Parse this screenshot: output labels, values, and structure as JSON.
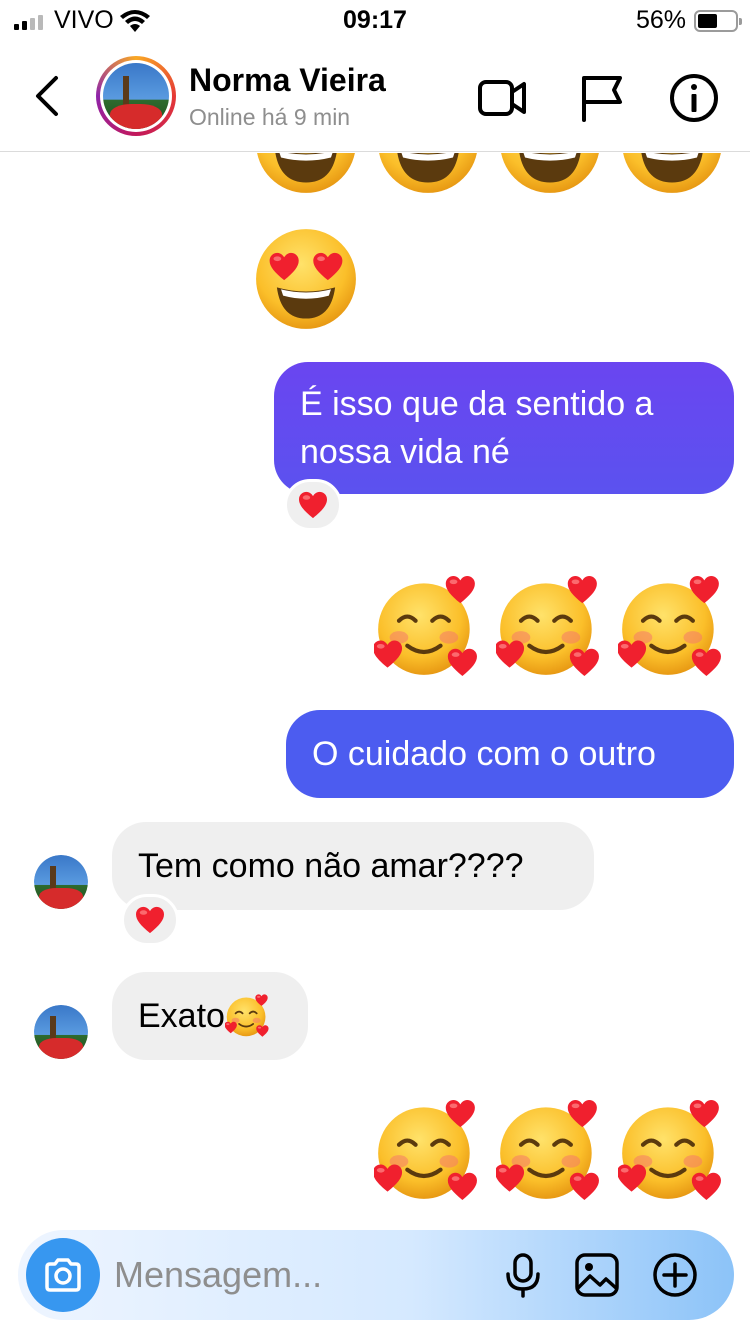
{
  "status_bar": {
    "carrier": "VIVO",
    "time": "09:17",
    "battery_percent": "56%",
    "battery_level": 0.56,
    "signal_bars": 2
  },
  "header": {
    "contact_name": "Norma Vieira",
    "contact_status": "Online há 9 min",
    "icons": [
      "back-icon",
      "video-call-icon",
      "flag-icon",
      "info-icon"
    ]
  },
  "messages": [
    {
      "type": "emoji",
      "side": "out",
      "emojis": [
        "grinning-face",
        "grinning-face",
        "grinning-face",
        "grinning-face"
      ]
    },
    {
      "type": "emoji",
      "side": "out",
      "emojis": [
        "heart-eyes-face"
      ]
    },
    {
      "type": "text",
      "side": "out",
      "text": "É isso que da sentido a nossa vida né",
      "reaction": "red-heart"
    },
    {
      "type": "emoji",
      "side": "out",
      "emojis": [
        "smiling-face-with-hearts",
        "smiling-face-with-hearts",
        "smiling-face-with-hearts"
      ]
    },
    {
      "type": "text",
      "side": "out",
      "text": "O cuidado com o outro"
    },
    {
      "type": "text",
      "side": "in",
      "text": "Tem como não amar????",
      "reaction": "red-heart"
    },
    {
      "type": "text",
      "side": "in",
      "text": "Exato",
      "inline_emoji": "smiling-face-with-hearts"
    },
    {
      "type": "emoji",
      "side": "out",
      "emojis": [
        "smiling-face-with-hearts",
        "smiling-face-with-hearts",
        "smiling-face-with-hearts"
      ]
    }
  ],
  "composer": {
    "placeholder": "Mensagem...",
    "icons": [
      "camera-icon",
      "microphone-icon",
      "gallery-icon",
      "add-icon"
    ]
  },
  "colors": {
    "bubble_out_top": "#6a45f0",
    "bubble_out_bottom": "#4a62ee",
    "bubble_in": "#efefef",
    "camera_button": "#3797f0"
  }
}
